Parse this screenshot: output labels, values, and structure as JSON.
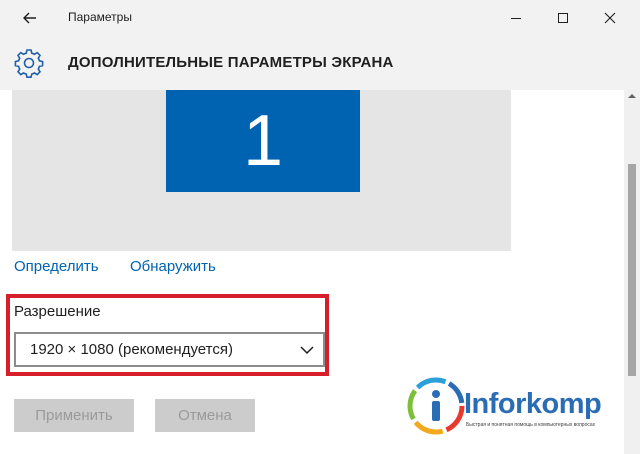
{
  "titlebar": {
    "app_title": "Параметры",
    "back_icon": "back-arrow-icon",
    "minimize_icon": "minimize-icon",
    "maximize_icon": "maximize-icon",
    "close_icon": "close-icon"
  },
  "header": {
    "icon": "gear-icon",
    "title": "ДОПОЛНИТЕЛЬНЫЕ ПАРАМЕТРЫ ЭКРАНА"
  },
  "display_preview": {
    "monitor_number": "1",
    "monitor_color": "#0063b1"
  },
  "links": {
    "identify": "Определить",
    "detect": "Обнаружить"
  },
  "resolution": {
    "label": "Разрешение",
    "selected_value": "1920 × 1080 (рекомендуется)",
    "highlight_color": "#d71f2b"
  },
  "buttons": {
    "apply": "Применить",
    "cancel": "Отмена"
  },
  "watermark": {
    "brand": "Inforkomp",
    "tagline": "Быстрая и понятная помощь в компьютерных вопросах"
  },
  "colors": {
    "accent": "#0063b1",
    "header_bg": "#f2f2f2",
    "preview_bg": "#e5e5e5",
    "button_disabled_bg": "#cccccc"
  }
}
